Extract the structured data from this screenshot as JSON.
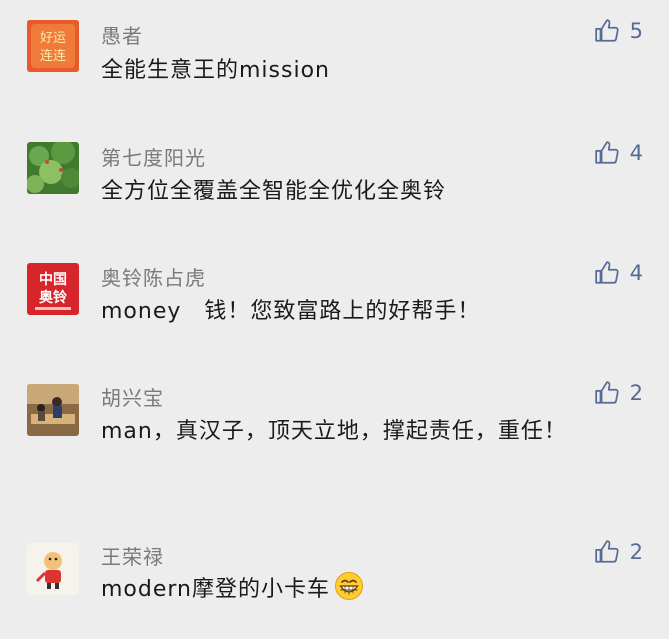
{
  "comments": [
    {
      "name": "愚者",
      "text": "全能生意王的mission",
      "likes": "5",
      "avatar": {
        "text1": "好运",
        "text2": "连连",
        "bg": "#e85a2a",
        "fg": "#ffe9a8"
      }
    },
    {
      "name": "第七度阳光",
      "text": "全方位全覆盖全智能全优化全奥铃",
      "likes": "4"
    },
    {
      "name": "奥铃陈占虎",
      "text": "money　钱！您致富路上的好帮手！",
      "likes": "4",
      "avatar": {
        "text1": "中国",
        "text2": "奥铃",
        "bg": "#d6262b",
        "fg": "#ffffff"
      }
    },
    {
      "name": "胡兴宝",
      "text": "man，真汉子，顶天立地，撑起责任，重任！",
      "likes": "2"
    },
    {
      "name": "王荣禄",
      "text": "modern摩登的小卡车",
      "likes": "2",
      "emoji": "grinning-face-emoji"
    }
  ],
  "colors": {
    "background": "#ededed",
    "name": "#7a7a7a",
    "text": "#1a1a1a",
    "like": "#576b95"
  }
}
